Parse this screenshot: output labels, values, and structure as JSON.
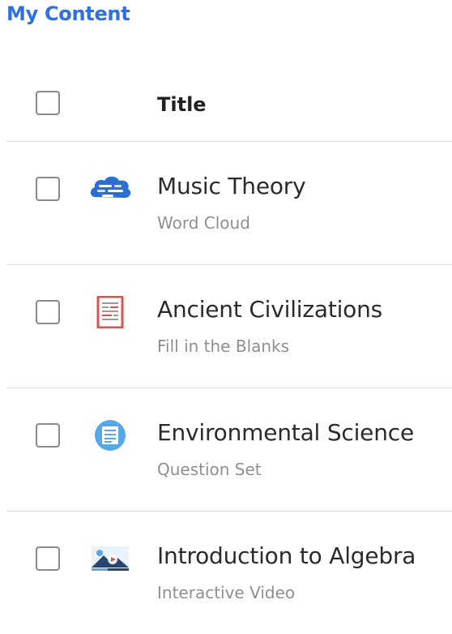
{
  "page": {
    "title": "My Content"
  },
  "table": {
    "header_title": "Title",
    "rows": [
      {
        "title": "Music Theory",
        "type": "Word Cloud",
        "icon": "word-cloud-icon",
        "checked": false
      },
      {
        "title": "Ancient Civilizations",
        "type": "Fill in the Blanks",
        "icon": "fill-in-blanks-icon",
        "checked": false
      },
      {
        "title": "Environmental Science",
        "type": "Question Set",
        "icon": "question-set-icon",
        "checked": false
      },
      {
        "title": "Introduction to Algebra",
        "type": "Interactive Video",
        "icon": "interactive-video-icon",
        "checked": false
      }
    ]
  },
  "colors": {
    "accent": "#2f6fe0",
    "word_cloud": "#2a6fd6",
    "fill_blanks": "#d9534f",
    "question_set": "#5aa7e6",
    "video": "#27466e"
  }
}
